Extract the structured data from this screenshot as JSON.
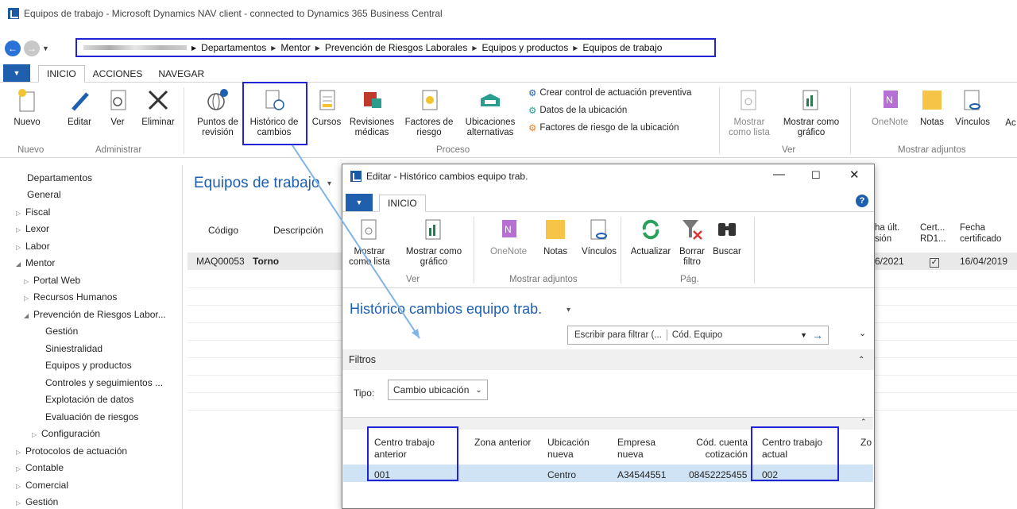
{
  "window": {
    "title": "Equipos de trabajo - Microsoft Dynamics NAV client - connected to Dynamics 365 Business Central"
  },
  "breadcrumb": [
    "Departamentos",
    "Mentor",
    "Prevención de Riesgos Laborales",
    "Equipos y productos",
    "Equipos de trabajo"
  ],
  "ribbon_tabs": [
    "INICIO",
    "ACCIONES",
    "NAVEGAR"
  ],
  "ribbon": {
    "nuevo": "Nuevo",
    "editar": "Editar",
    "ver": "Ver",
    "eliminar": "Eliminar",
    "puntos": "Puntos de revisión",
    "historico": "Histórico de cambios",
    "cursos": "Cursos",
    "revisiones": "Revisiones médicas",
    "factores": "Factores de riesgo",
    "ubicaciones": "Ubicaciones alternativas",
    "crear_control": "Crear control de actuación preventiva",
    "datos_ubicacion": "Datos de la ubicación",
    "factores_ubicacion": "Factores de riesgo de la ubicación",
    "mostrar_lista": "Mostrar como lista",
    "mostrar_grafico": "Mostrar como gráfico",
    "onenote": "OneNote",
    "notas": "Notas",
    "vinculos": "Vínculos",
    "ac": "Ac",
    "groups": {
      "nuevo": "Nuevo",
      "administrar": "Administrar",
      "proceso": "Proceso",
      "ver": "Ver",
      "adjuntos": "Mostrar adjuntos"
    }
  },
  "sidebar": [
    "Departamentos",
    "General",
    "Fiscal",
    "Lexor",
    "Labor",
    "Mentor",
    "Portal Web",
    "Recursos Humanos",
    "Prevención de Riesgos Labor...",
    "Gestión",
    "Siniestralidad",
    "Equipos y productos",
    "Controles y seguimientos ...",
    "Explotación de datos",
    "Evaluación de riesgos",
    "Configuración",
    "Protocolos de actuación",
    "Contable",
    "Comercial",
    "Gestión"
  ],
  "page": {
    "title": "Equipos de trabajo",
    "columns": {
      "codigo": "Código",
      "descripcion": "Descripción",
      "ult": "ha últ. sión",
      "cert": "Cert... RD1...",
      "fecha": "Fecha certificado"
    },
    "row": {
      "codigo": "MAQ00053",
      "descripcion": "Torno",
      "ult": "6/2021",
      "fecha": "16/04/2019"
    }
  },
  "dialog": {
    "title": "Editar - Histórico cambios equipo trab.",
    "tab": "INICIO",
    "ribbon": {
      "mostrar_lista": "Mostrar como lista",
      "mostrar_grafico": "Mostrar como gráfico",
      "onenote": "OneNote",
      "notas": "Notas",
      "vinculos": "Vínculos",
      "actualizar": "Actualizar",
      "borrar_filtro": "Borrar filtro",
      "buscar": "Buscar",
      "groups": {
        "ver": "Ver",
        "adjuntos": "Mostrar adjuntos",
        "pag": "Pág."
      }
    },
    "page_title": "Histórico cambios equipo trab.",
    "filter_placeholder": "Escribir para filtrar (...",
    "filter_field": "Cód. Equipo",
    "filters_label": "Filtros",
    "tipo_label": "Tipo:",
    "tipo_value": "Cambio ubicación",
    "columns": [
      "Centro trabajo anterior",
      "Zona anterior",
      "Ubicación nueva",
      "Empresa nueva",
      "Cód. cuenta cotización",
      "Centro trabajo actual",
      "Zo"
    ],
    "row": [
      "001",
      "",
      "Centro",
      "A34544551",
      "08452225455",
      "002",
      ""
    ]
  }
}
